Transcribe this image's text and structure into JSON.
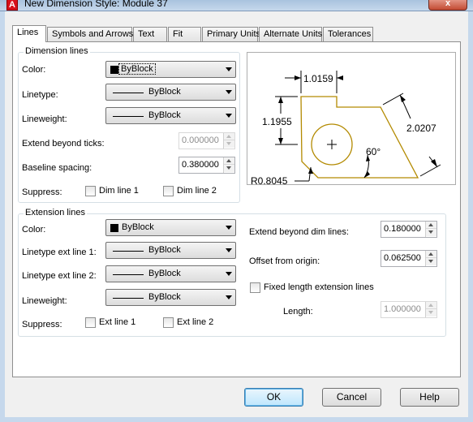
{
  "window": {
    "title": "New Dimension Style: Module 37",
    "close_label": "x",
    "app_icon_letter": "A"
  },
  "tabs": [
    "Lines",
    "Symbols and Arrows",
    "Text",
    "Fit",
    "Primary Units",
    "Alternate Units",
    "Tolerances"
  ],
  "dimension_lines": {
    "legend": "Dimension lines",
    "color_label": "Color:",
    "color_value": "ByBlock",
    "linetype_label": "Linetype:",
    "linetype_value": "ByBlock",
    "lineweight_label": "Lineweight:",
    "lineweight_value": "ByBlock",
    "extend_label": "Extend beyond ticks:",
    "extend_value": "0.000000",
    "baseline_label": "Baseline spacing:",
    "baseline_value": "0.380000",
    "suppress_label": "Suppress:",
    "dim1_label": "Dim line 1",
    "dim2_label": "Dim line 2"
  },
  "extension_lines": {
    "legend": "Extension lines",
    "color_label": "Color:",
    "color_value": "ByBlock",
    "lt1_label": "Linetype ext line 1:",
    "lt1_value": "ByBlock",
    "lt2_label": "Linetype ext line 2:",
    "lt2_value": "ByBlock",
    "lineweight_label": "Lineweight:",
    "lineweight_value": "ByBlock",
    "suppress_label": "Suppress:",
    "ext1_label": "Ext line 1",
    "ext2_label": "Ext line 2",
    "extend_label": "Extend beyond dim lines:",
    "extend_value": "0.180000",
    "offset_label": "Offset from origin:",
    "offset_value": "0.062500",
    "fixed_label": "Fixed length extension lines",
    "length_label": "Length:",
    "length_value": "1.000000"
  },
  "preview": {
    "dim_top": "1.0159",
    "dim_left": "1.1955",
    "dim_right": "2.0207",
    "angle": "60°",
    "radius": "R0.8045"
  },
  "buttons": {
    "ok": "OK",
    "cancel": "Cancel",
    "help": "Help"
  }
}
